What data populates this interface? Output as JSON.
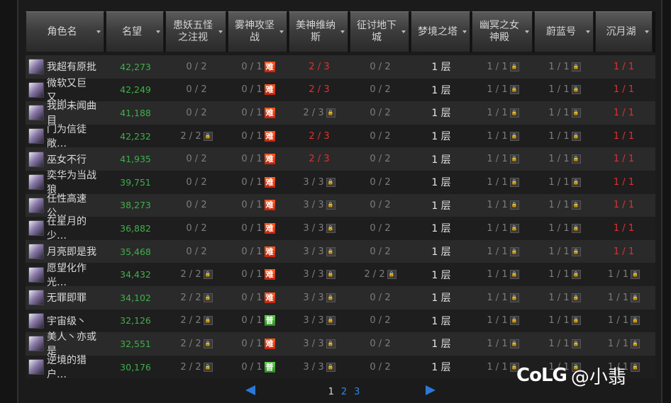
{
  "columns": [
    "角色名",
    "名望",
    "患妖五怪之注视",
    "雾神攻坚战",
    "美神维纳斯",
    "征讨地下城",
    "梦境之塔",
    "幽冥之女神殿",
    "蔚蓝号",
    "沉月湖"
  ],
  "rows": [
    {
      "name": "我超有原批",
      "fame": "42,273",
      "c1": "0 / 2",
      "c2": "0 / 1",
      "c2b": "难",
      "c3": "2 / 3",
      "c3r": true,
      "c3l": false,
      "c4": "0 / 2",
      "c4l": false,
      "c5": "1 层",
      "c6": "1 / 1",
      "c7": "1 / 1",
      "c8": "1 / 1",
      "c8r": true,
      "c8l": false
    },
    {
      "name": "微软又巨又…",
      "fame": "42,249",
      "c1": "0 / 2",
      "c2": "0 / 1",
      "c2b": "难",
      "c3": "2 / 3",
      "c3r": true,
      "c3l": false,
      "c4": "0 / 2",
      "c4l": false,
      "c5": "1 层",
      "c6": "1 / 1",
      "c7": "1 / 1",
      "c8": "1 / 1",
      "c8r": true,
      "c8l": false
    },
    {
      "name": "我即未闻曲目",
      "fame": "41,188",
      "c1": "0 / 2",
      "c2": "0 / 1",
      "c2b": "难",
      "c3": "2 / 3",
      "c3r": false,
      "c3l": true,
      "c4": "0 / 2",
      "c4l": false,
      "c5": "1 层",
      "c6": "1 / 1",
      "c7": "1 / 1",
      "c8": "1 / 1",
      "c8r": true,
      "c8l": false
    },
    {
      "name": "门为信徒敞…",
      "fame": "42,232",
      "c1": "2 / 2",
      "c1l": true,
      "c2": "0 / 1",
      "c2b": "难",
      "c3": "2 / 3",
      "c3r": true,
      "c3l": false,
      "c4": "0 / 2",
      "c4l": false,
      "c5": "1 层",
      "c6": "1 / 1",
      "c7": "1 / 1",
      "c8": "1 / 1",
      "c8r": true,
      "c8l": false
    },
    {
      "name": "巫女不行",
      "fame": "41,935",
      "c1": "0 / 2",
      "c2": "0 / 1",
      "c2b": "难",
      "c3": "2 / 3",
      "c3r": true,
      "c3l": false,
      "c4": "0 / 2",
      "c4l": false,
      "c5": "1 层",
      "c6": "1 / 1",
      "c7": "1 / 1",
      "c8": "1 / 1",
      "c8r": true,
      "c8l": false
    },
    {
      "name": "奕华为当战狼",
      "fame": "39,751",
      "c1": "0 / 2",
      "c2": "0 / 1",
      "c2b": "难",
      "c3": "3 / 3",
      "c3r": false,
      "c3l": true,
      "c4": "0 / 2",
      "c4l": false,
      "c5": "1 层",
      "c6": "1 / 1",
      "c7": "1 / 1",
      "c8": "1 / 1",
      "c8r": true,
      "c8l": false
    },
    {
      "name": "任性高速公…",
      "fame": "38,273",
      "c1": "0 / 2",
      "c2": "0 / 1",
      "c2b": "难",
      "c3": "3 / 3",
      "c3r": false,
      "c3l": true,
      "c4": "0 / 2",
      "c4l": false,
      "c5": "1 层",
      "c6": "1 / 1",
      "c7": "1 / 1",
      "c8": "1 / 1",
      "c8r": true,
      "c8l": false
    },
    {
      "name": "在星月的少…",
      "fame": "36,882",
      "c1": "0 / 2",
      "c2": "0 / 1",
      "c2b": "难",
      "c3": "3 / 3",
      "c3r": false,
      "c3l": true,
      "c4": "0 / 2",
      "c4l": false,
      "c5": "1 层",
      "c6": "1 / 1",
      "c7": "1 / 1",
      "c8": "1 / 1",
      "c8r": true,
      "c8l": false
    },
    {
      "name": "月亮即是我",
      "fame": "35,468",
      "c1": "0 / 2",
      "c2": "0 / 1",
      "c2b": "难",
      "c3": "3 / 3",
      "c3r": false,
      "c3l": true,
      "c4": "0 / 2",
      "c4l": false,
      "c5": "1 层",
      "c6": "1 / 1",
      "c7": "1 / 1",
      "c8": "1 / 1",
      "c8r": true,
      "c8l": false
    },
    {
      "name": "愿望化作光…",
      "fame": "34,432",
      "c1": "2 / 2",
      "c1l": true,
      "c2": "0 / 1",
      "c2b": "难",
      "c3": "3 / 3",
      "c3r": false,
      "c3l": true,
      "c4": "2 / 2",
      "c4l": true,
      "c5": "1 层",
      "c6": "1 / 1",
      "c7": "1 / 1",
      "c8": "1 / 1",
      "c8r": false,
      "c8l": true
    },
    {
      "name": "无罪即罪",
      "fame": "34,102",
      "c1": "2 / 2",
      "c1l": true,
      "c2": "0 / 1",
      "c2b": "难",
      "c3": "3 / 3",
      "c3r": false,
      "c3l": true,
      "c4": "0 / 2",
      "c4l": false,
      "c5": "1 层",
      "c6": "1 / 1",
      "c7": "1 / 1",
      "c8": "1 / 1",
      "c8r": false,
      "c8l": true
    },
    {
      "name": "宇宙级丶",
      "fame": "32,126",
      "c1": "2 / 2",
      "c1l": true,
      "c2": "0 / 1",
      "c2b": "普",
      "c3": "3 / 3",
      "c3r": false,
      "c3l": true,
      "c4": "0 / 2",
      "c4l": false,
      "c5": "1 层",
      "c6": "1 / 1",
      "c7": "1 / 1",
      "c8": "1 / 1",
      "c8r": false,
      "c8l": true
    },
    {
      "name": "美人丶亦或是",
      "fame": "32,551",
      "c1": "2 / 2",
      "c1l": true,
      "c2": "0 / 1",
      "c2b": "难",
      "c3": "3 / 3",
      "c3r": false,
      "c3l": true,
      "c4": "0 / 2",
      "c4l": false,
      "c5": "1 层",
      "c6": "1 / 1",
      "c7": "1 / 1",
      "c8": "1 / 1",
      "c8r": false,
      "c8l": true
    },
    {
      "name": "逆境的猎户…",
      "fame": "30,176",
      "c1": "2 / 2",
      "c1l": true,
      "c2": "0 / 1",
      "c2b": "普",
      "c3": "3 / 3",
      "c3r": false,
      "c3l": true,
      "c4": "0 / 2",
      "c4l": false,
      "c5": "1 层",
      "c6": "1 / 1",
      "c7": "1 / 1",
      "c8": "1 / 1",
      "c8r": false,
      "c8l": true
    }
  ],
  "pager": {
    "pages": [
      "1",
      "2",
      "3"
    ],
    "current": "1"
  },
  "watermark": {
    "logo": "CoLG",
    "text": "@小翡"
  },
  "colors": {
    "accent_blue": "#2b78d8",
    "fame_green": "#3fb04a",
    "alert_red": "#e03030",
    "hard_badge": "#e0401a",
    "normal_badge": "#3aa82c"
  }
}
